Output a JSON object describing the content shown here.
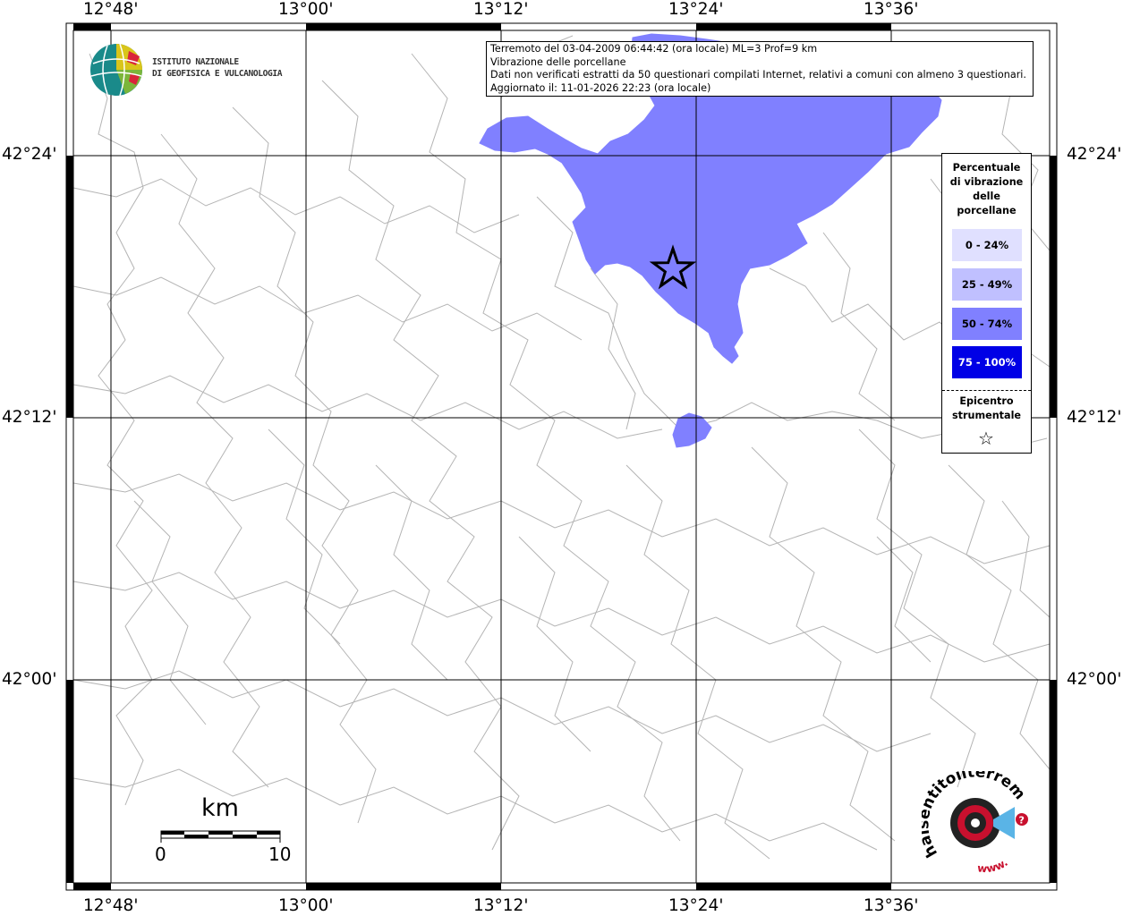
{
  "header": {
    "line1": "Terremoto del 03-04-2009 06:44:42 (ora locale) ML=3 Prof=9 km",
    "line2": "Vibrazione delle porcellane",
    "line3": "Dati non verificati estratti da 50 questionari compilati Internet, relativi a comuni con almeno 3 questionari.",
    "line4": "Aggiornato il: 11-01-2026 22:23 (ora locale)"
  },
  "logo_ingv": {
    "line1": "ISTITUTO NAZIONALE",
    "line2": "DI GEOFISICA E VULCANOLOGIA"
  },
  "legend": {
    "title_lines": [
      "Percentuale",
      "di vibrazione",
      "delle",
      "porcellane"
    ],
    "classes": [
      {
        "label": "0 - 24%",
        "color": "#e0e0ff",
        "text_color": "#000000"
      },
      {
        "label": "25 - 49%",
        "color": "#c0c0ff",
        "text_color": "#000000"
      },
      {
        "label": "50 - 74%",
        "color": "#8080ff",
        "text_color": "#000000"
      },
      {
        "label": "75 - 100%",
        "color": "#0000e6",
        "text_color": "#ffffff"
      }
    ],
    "epicenter_lines": [
      "Epicentro",
      "strumentale"
    ],
    "epicenter_symbol": "☆"
  },
  "axes": {
    "lon_labels": [
      "12°48'",
      "13°00'",
      "13°12'",
      "13°24'",
      "13°36'"
    ],
    "lat_labels": [
      "42°24'",
      "42°12'",
      "42°00'"
    ]
  },
  "scale_bar": {
    "unit": "km",
    "start": "0",
    "end": "10"
  },
  "logo_hai": {
    "text": "haisentitoilterremoto.it",
    "www": "www."
  },
  "colors": {
    "fill": "#8080ff",
    "boundary": "#b4b4b4",
    "grid": "#000000"
  }
}
